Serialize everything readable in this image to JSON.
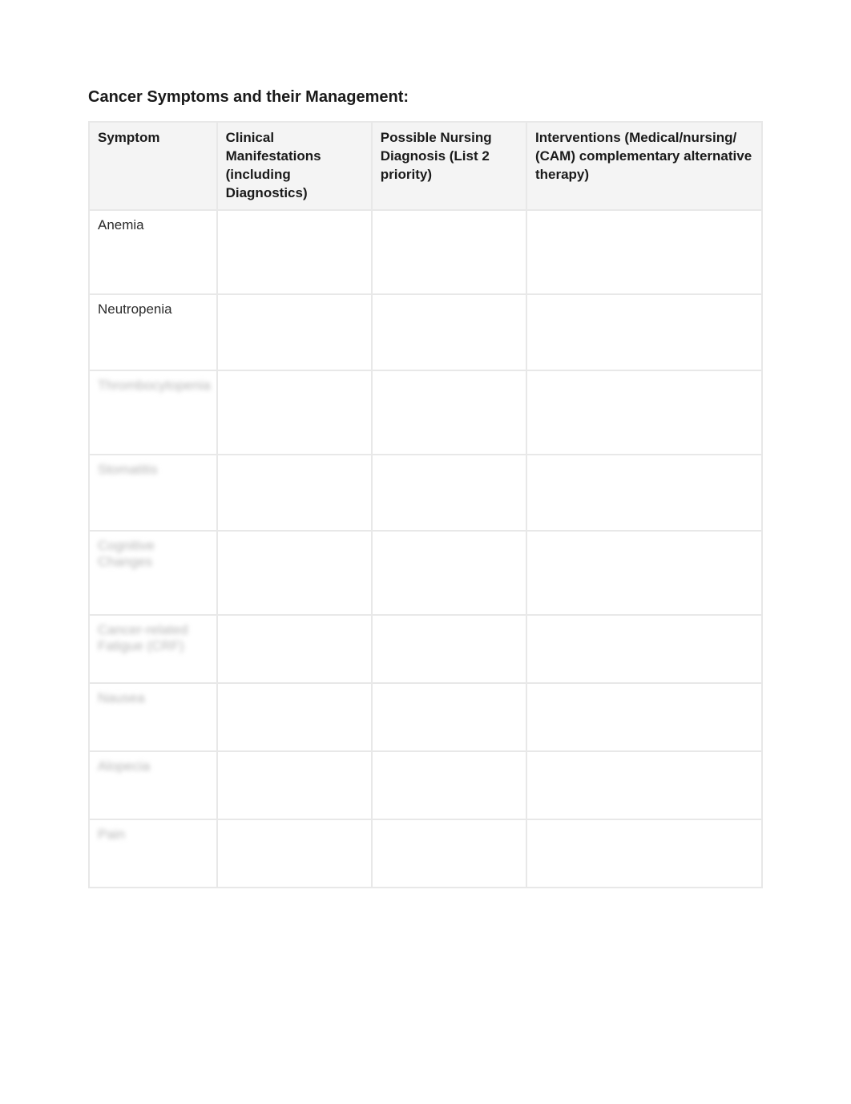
{
  "title": "Cancer Symptoms and their Management:",
  "headers": {
    "symptom": "Symptom",
    "clinical": "Clinical Manifestations (including Diagnostics)",
    "nursing": "Possible Nursing Diagnosis (List 2 priority)",
    "interventions": "Interventions (Medical/nursing/ (CAM) complementary alternative therapy)"
  },
  "rows": [
    {
      "symptom": "Anemia",
      "blurred": false,
      "height": "tall"
    },
    {
      "symptom": "Neutropenia",
      "blurred": false,
      "height": ""
    },
    {
      "symptom": "Thrombocytopenia",
      "blurred": true,
      "height": "tall"
    },
    {
      "symptom": "Stomatitis",
      "blurred": true,
      "height": ""
    },
    {
      "symptom": "Cognitive Changes",
      "blurred": true,
      "height": "tall"
    },
    {
      "symptom": "Cancer-related Fatigue (CRF)",
      "blurred": true,
      "height": "short"
    },
    {
      "symptom": "Nausea",
      "blurred": true,
      "height": "short"
    },
    {
      "symptom": "Alopecia",
      "blurred": true,
      "height": "short"
    },
    {
      "symptom": "Pain",
      "blurred": true,
      "height": "short"
    }
  ]
}
